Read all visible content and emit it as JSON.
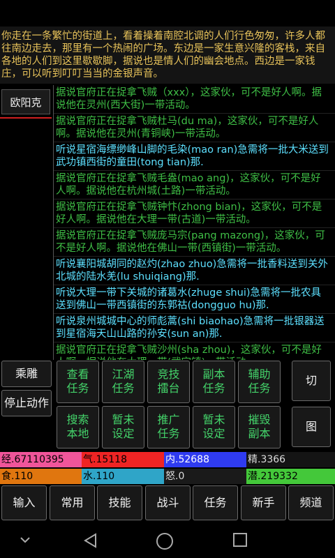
{
  "description": "你走在一条繁忙的街道上，看着操着南腔北调的人们行色匆匆，许多人都往南边走去，那里有一个热闹的广场。东边是一家生意兴隆的客栈，来自各地的人们到这里歇歇脚，据说也是情人们的幽会地点。西边是一家钱庄，可以听到叮叮当当的金银声音。",
  "npc": {
    "name": "欧阳克"
  },
  "log": [
    {
      "text": "据说官府正在捉拿飞贼（xxx），这家伙，可不是好人啊。据说他在灵州(西大街)一带活动。",
      "color": "green"
    },
    {
      "text": "据说官府正在捉拿飞贼杜马(du ma)，这家伙，可不是好人啊。据说他在灵州(青铜峡)一带活动。",
      "color": "green"
    },
    {
      "text": "听说星宿海缥缈峰山脚的毛染(mao ran)急需将一批大米送到武功镇西街的童田(tong tian)那.",
      "color": "cyan"
    },
    {
      "text": "据说官府正在捉拿飞贼毛盎(mao ang)，这家伙，可不是好人啊。据说他在杭州城(土路)一带活动。",
      "color": "green"
    },
    {
      "text": "据说官府正在捉拿飞贼钟忭(zhong bian)，这家伙，可不是好人啊。据说他在大理一带(古道)一带活动。",
      "color": "green"
    },
    {
      "text": "据说官府正在捉拿飞贼庞马宗(pang mazong)，这家伙，可不是好人啊。据说他在佛山一带(西镇街)一带活动。",
      "color": "green"
    },
    {
      "text": "听说襄阳城胡同的赵灼(zhao zhuo)急需将一批香料送到关外北城的陆水羌(lu shuiqiang)那.",
      "color": "cyan"
    },
    {
      "text": "听说大理一带下关城的诸葛水(zhuge shui)急需将一批农具送到佛山一带西镇街的东郭祜(dongguo hu)那.",
      "color": "cyan"
    },
    {
      "text": "听说泉州城城中心的师彪蒿(shi biaohao)急需将一批银器送到星宿海天山山路的孙安(sun an)那.",
      "color": "cyan"
    },
    {
      "text": "据说官府正在捉拿飞贼沙州(sha zhou)，这家伙，可不是好人啊。据说他在大理一带(武定镇)一带活动。",
      "color": "green"
    }
  ],
  "side_buttons": {
    "ride": "乘雕",
    "stop": "停止动作"
  },
  "grid": [
    [
      "查看",
      "任务"
    ],
    [
      "江湖",
      "任务"
    ],
    [
      "竞技",
      "擂台"
    ],
    [
      "副本",
      "任务"
    ],
    [
      "辅助",
      "任务"
    ],
    [
      "搜索",
      "本地"
    ],
    [
      "暂未",
      "设定"
    ],
    [
      "推广",
      "任务"
    ],
    [
      "暂未",
      "设定"
    ],
    [
      "摧毁",
      "副本"
    ]
  ],
  "right_buttons": {
    "switch": "切",
    "map": "图"
  },
  "stats": {
    "exp": "经.67110395",
    "qi": "气.15118",
    "nei": "内.52688",
    "jing": "精.3366",
    "food": "食.110",
    "water": "水.110",
    "nu": "怒.0",
    "qian": "潜.219332"
  },
  "colors": {
    "exp": "#f0559a",
    "qi": "#ef2424",
    "nei": "#2f3bf0",
    "jing": "#141414",
    "food": "#e0760f",
    "water": "#2fa5c8",
    "nu": "#1a1a1a",
    "qian": "#44c83a",
    "log_green": "#3fbf46",
    "log_cyan": "#5de0ff",
    "button_text": "#44d36a"
  },
  "bottom_buttons": [
    "输入",
    "常用",
    "技能",
    "战斗",
    "任务",
    "新手",
    "频道"
  ],
  "navbar_icons": [
    "chevron-down-icon",
    "back-icon",
    "home-icon",
    "recents-icon"
  ]
}
